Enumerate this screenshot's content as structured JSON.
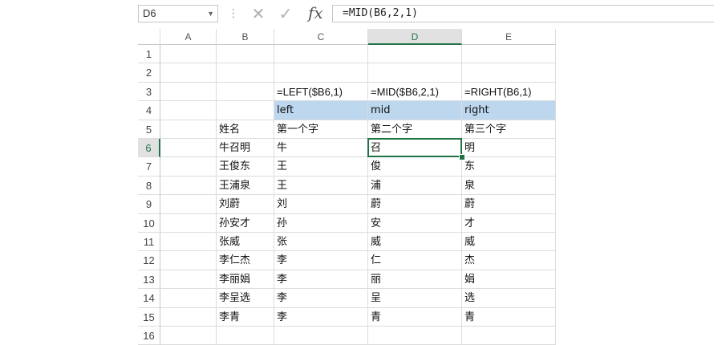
{
  "formula_bar": {
    "name_box": "D6",
    "name_box_arrow": "▼",
    "dots": "⋮",
    "cancel_glyph": "✕",
    "enter_glyph": "✓",
    "fx_label": "fx",
    "formula": "=MID(B6,2,1)"
  },
  "columns": [
    "A",
    "B",
    "C",
    "D",
    "E"
  ],
  "rows": [
    "1",
    "2",
    "3",
    "4",
    "5",
    "6",
    "7",
    "8",
    "9",
    "10",
    "11",
    "12",
    "13",
    "14",
    "15",
    "16"
  ],
  "active": {
    "column": "D",
    "row": "6"
  },
  "cells": {
    "C3": "=LEFT($B6,1)",
    "D3": "=MID($B6,2,1)",
    "E3": "=RIGHT(B6,1)",
    "C4": "left",
    "D4": "mid",
    "E4": "right",
    "B5": "姓名",
    "C5": "第一个字",
    "D5": "第二个字",
    "E5": "第三个字",
    "B6": "牛召明",
    "C6": "牛",
    "D6": "召",
    "E6": "明",
    "B7": "王俊东",
    "C7": "王",
    "D7": "俊",
    "E7": "东",
    "B8": "王浦泉",
    "C8": "王",
    "D8": "浦",
    "E8": "泉",
    "B9": "刘蔚",
    "C9": "刘",
    "D9": "蔚",
    "E9": "蔚",
    "B10": "孙安才",
    "C10": "孙",
    "D10": "安",
    "E10": "才",
    "B11": "张威",
    "C11": "张",
    "D11": "威",
    "E11": "威",
    "B12": "李仁杰",
    "C12": "李",
    "D12": "仁",
    "E12": "杰",
    "B13": "李丽娟",
    "C13": "李",
    "D13": "丽",
    "E13": "娟",
    "B14": "李呈选",
    "C14": "李",
    "D14": "呈",
    "E14": "选",
    "B15": "李青",
    "C15": "李",
    "D15": "青",
    "E15": "青"
  },
  "colors": {
    "accent": "#217346",
    "header_fill": "#bdd7ee"
  }
}
